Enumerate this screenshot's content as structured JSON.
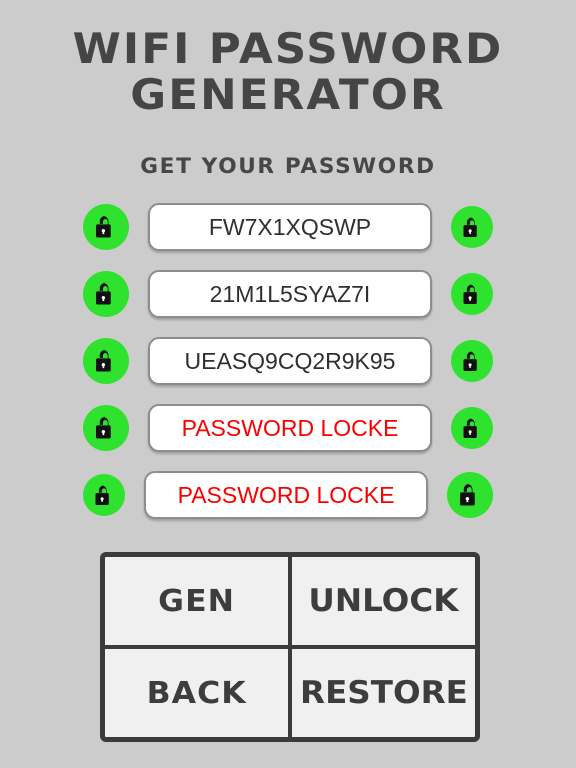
{
  "app": {
    "title_line1": "WIFI PASSWORD",
    "title_line2": "GENERATOR",
    "section_title": "GET YOUR PASSWORD"
  },
  "colors": {
    "background": "#cccccc",
    "title_text": "#454545",
    "lock_green": "#2ee22e",
    "locked_text": "#fb0000",
    "field_background": "#ffffff",
    "field_border": "#8d8d8d",
    "grid_border": "#3b3b3b",
    "grid_button_fill": "#f0f0f0"
  },
  "rows": [
    {
      "left_icon": "unlocked-padlock-icon",
      "right_icon": "unlocked-padlock-icon",
      "value": "FW7X1XQSWP",
      "state": "unlocked"
    },
    {
      "left_icon": "unlocked-padlock-icon",
      "right_icon": "unlocked-padlock-icon",
      "value": "21M1L5SYAZ7I",
      "state": "unlocked"
    },
    {
      "left_icon": "unlocked-padlock-icon",
      "right_icon": "unlocked-padlock-icon",
      "value": "UEASQ9CQ2R9K95",
      "state": "unlocked"
    },
    {
      "left_icon": "unlocked-padlock-icon",
      "right_icon": "unlocked-padlock-icon",
      "value": "PASSWORD LOCKE",
      "state": "locked"
    },
    {
      "left_icon": "unlocked-padlock-icon",
      "right_icon": "unlocked-padlock-icon",
      "value": "PASSWORD LOCKE",
      "state": "locked"
    }
  ],
  "buttons": {
    "gen": "GEN",
    "unlock": "UNLOCK",
    "back": "BACK",
    "restore": "RESTORE"
  }
}
